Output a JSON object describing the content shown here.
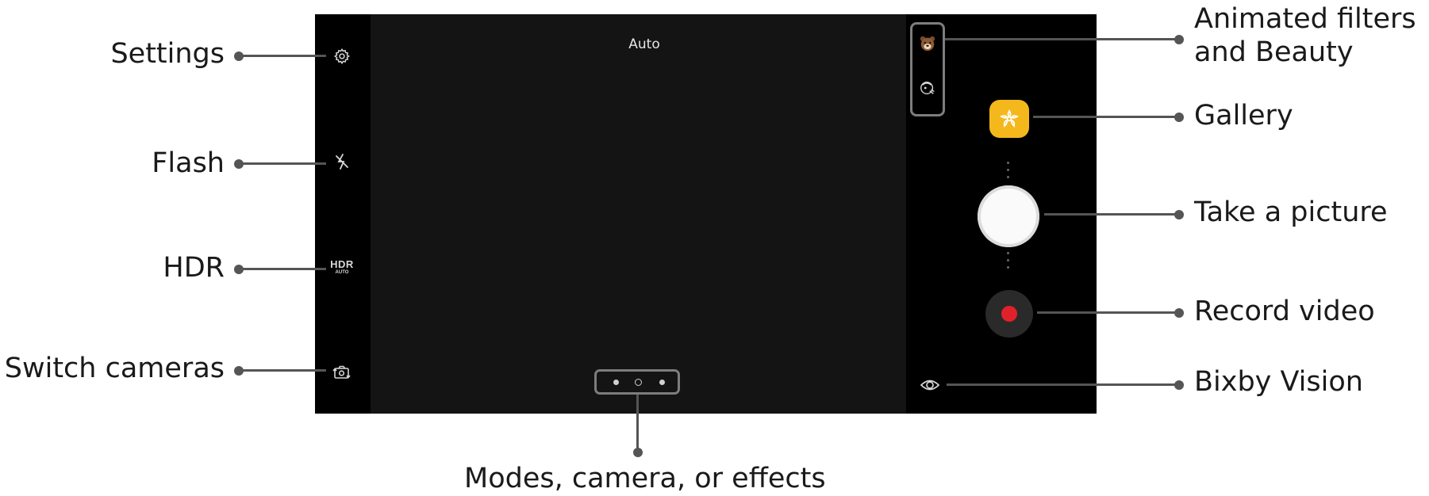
{
  "screen": {
    "mode_label": "Auto",
    "hdr_icon": {
      "main": "HDR",
      "sub": "AUTO"
    }
  },
  "icons": {
    "settings": "gear-icon",
    "flash": "flash-off-icon",
    "switch": "switch-camera-icon",
    "animated_filter": "bear-face-icon",
    "beauty": "beauty-face-icon",
    "gallery": "gallery-flower-icon",
    "bixby": "bixby-vision-eye-icon"
  },
  "colors": {
    "gallery": "#f5b81c",
    "record": "#e0212b",
    "shutter": "#fafafa"
  },
  "callouts": {
    "settings": "Settings",
    "flash": "Flash",
    "hdr": "HDR",
    "switch_cameras": "Switch cameras",
    "animated_filters_line1": "Animated filters",
    "animated_filters_line2": "and Beauty",
    "gallery": "Gallery",
    "take_picture": "Take a picture",
    "record_video": "Record video",
    "bixby_vision": "Bixby Vision",
    "modes": "Modes, camera, or effects"
  }
}
